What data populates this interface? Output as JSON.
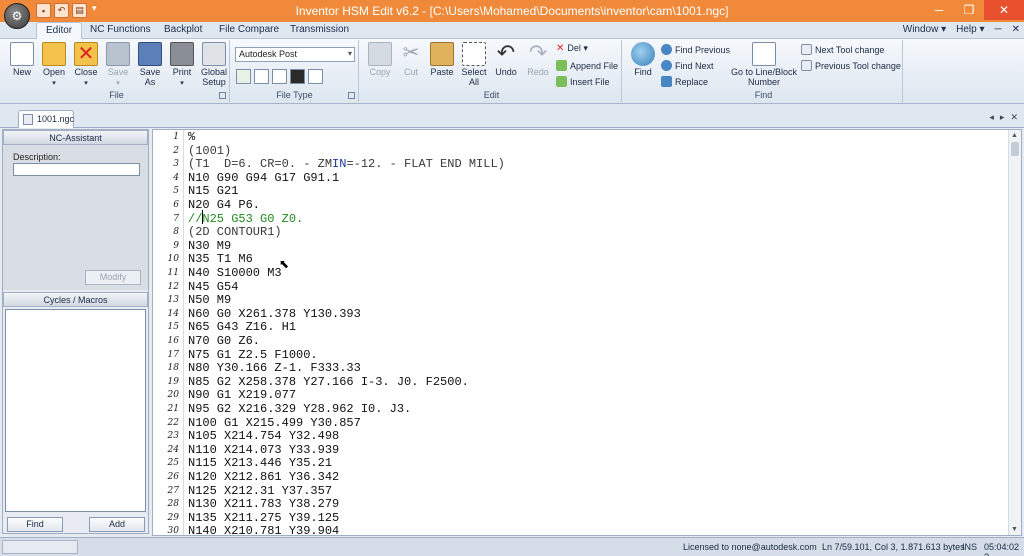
{
  "window": {
    "title": "Inventor HSM Edit v6.2 - [C:\\Users\\Mohamed\\Documents\\inventor\\cam\\1001.ngc]",
    "minimize": "─",
    "restore": "❐",
    "close": "✕"
  },
  "ribbon_tabs": [
    {
      "label": "Editor",
      "active": true
    },
    {
      "label": "NC Functions",
      "active": false
    },
    {
      "label": "Backplot",
      "active": false
    },
    {
      "label": "File Compare",
      "active": false
    },
    {
      "label": "Transmission",
      "active": false
    }
  ],
  "ribbon_right": {
    "window": "Window ▾",
    "help": "Help ▾",
    "min": "─",
    "close": "✕"
  },
  "ribbon": {
    "file": {
      "label": "File",
      "buttons": {
        "new": "New",
        "open": "Open",
        "close": "Close",
        "save": "Save",
        "save_as": "Save As",
        "print": "Print",
        "global_setup": "Global Setup"
      }
    },
    "file_type": {
      "label": "File Type",
      "post": "Autodesk Post"
    },
    "edit": {
      "label": "Edit",
      "buttons": {
        "copy": "Copy",
        "cut": "Cut",
        "paste": "Paste",
        "select_all": "Select All",
        "undo": "Undo",
        "redo": "Redo",
        "del": "Del ▾",
        "append_file": "Append File",
        "insert_file": "Insert File"
      }
    },
    "find": {
      "label": "Find",
      "buttons": {
        "find": "Find",
        "find_previous": "Find Previous",
        "find_next": "Find Next",
        "replace": "Replace",
        "goto_line": "Go to Line/Block Number",
        "next_tool": "Next Tool change",
        "prev_tool": "Previous Tool change"
      }
    }
  },
  "doc_tab": {
    "label": "1001.ngc"
  },
  "doc_nav": {
    "prev": "◂",
    "next": "▸",
    "close": "✕"
  },
  "nc_assistant": {
    "header": "NC-Assistant",
    "description_label": "Description:",
    "description_value": "",
    "modify": "Modify"
  },
  "cycles": {
    "header": "Cycles / Macros",
    "find": "Find",
    "add": "Add"
  },
  "editor": {
    "lines": [
      {
        "n": "1",
        "text": "%"
      },
      {
        "n": "2",
        "text": "(1001)"
      },
      {
        "n": "3",
        "text": "(T1  D=6. CR=0. - ZMIN=-12. - FLAT END MILL)"
      },
      {
        "n": "4",
        "text": "N10 G90 G94 G17 G91.1"
      },
      {
        "n": "5",
        "text": "N15 G21"
      },
      {
        "n": "6",
        "text": "N20 G4 P6."
      },
      {
        "n": "7",
        "text": "//N25 G53 G0 Z0."
      },
      {
        "n": "8",
        "text": "(2D CONTOUR1)"
      },
      {
        "n": "9",
        "text": "N30 M9"
      },
      {
        "n": "10",
        "text": "N35 T1 M6"
      },
      {
        "n": "11",
        "text": "N40 S10000 M3"
      },
      {
        "n": "12",
        "text": "N45 G54"
      },
      {
        "n": "13",
        "text": "N50 M9"
      },
      {
        "n": "14",
        "text": "N60 G0 X261.378 Y130.393"
      },
      {
        "n": "15",
        "text": "N65 G43 Z16. H1"
      },
      {
        "n": "16",
        "text": "N70 G0 Z6."
      },
      {
        "n": "17",
        "text": "N75 G1 Z2.5 F1000."
      },
      {
        "n": "18",
        "text": "N80 Y30.166 Z-1. F333.33"
      },
      {
        "n": "19",
        "text": "N85 G2 X258.378 Y27.166 I-3. J0. F2500."
      },
      {
        "n": "20",
        "text": "N90 G1 X219.077"
      },
      {
        "n": "21",
        "text": "N95 G2 X216.329 Y28.962 I0. J3."
      },
      {
        "n": "22",
        "text": "N100 G1 X215.499 Y30.857"
      },
      {
        "n": "23",
        "text": "N105 X214.754 Y32.498"
      },
      {
        "n": "24",
        "text": "N110 X214.073 Y33.939"
      },
      {
        "n": "25",
        "text": "N115 X213.446 Y35.21"
      },
      {
        "n": "26",
        "text": "N120 X212.861 Y36.342"
      },
      {
        "n": "27",
        "text": "N125 X212.31 Y37.357"
      },
      {
        "n": "28",
        "text": "N130 X211.783 Y38.279"
      },
      {
        "n": "29",
        "text": "N135 X211.275 Y39.125"
      },
      {
        "n": "30",
        "text": "N140 X210.781 Y39.904"
      }
    ]
  },
  "status": {
    "license": "Licensed to none@autodesk.com",
    "position": "Ln 7/59.101, Col 3, 1.871.613 bytes",
    "mode": "INS",
    "time": "05:04:02 ?"
  },
  "colors": {
    "titlebar": "#f08a3a",
    "comment": "#3a3a3a",
    "disabled_line": "#1f8a1f",
    "keyword_in": "#1a3a9a"
  }
}
